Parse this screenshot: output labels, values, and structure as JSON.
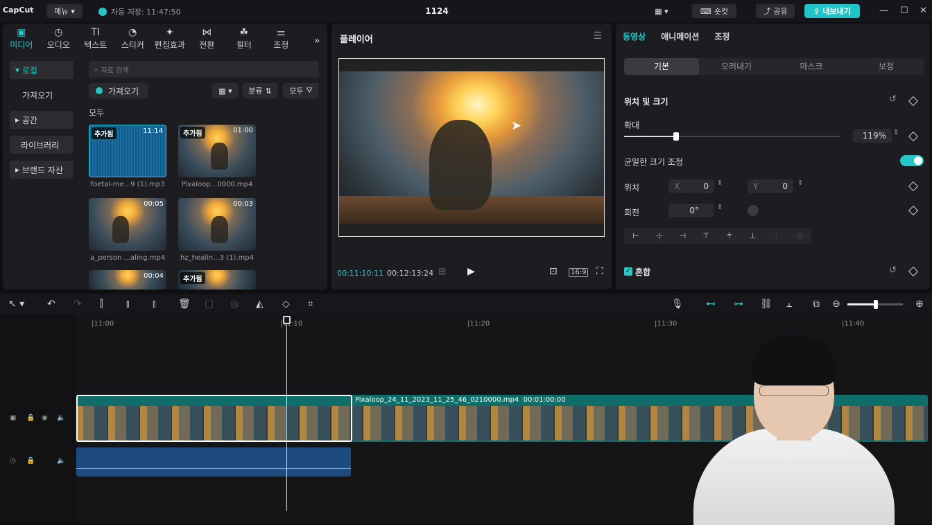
{
  "titlebar": {
    "logo": "CapCut",
    "menu_label": "메뉴",
    "autosave": "자동 저장: 11:47:50",
    "project_title": "1124",
    "shortcut_label": "숏컷",
    "share_label": "공유",
    "export_label": "내보내기"
  },
  "media_tabs": [
    {
      "label": "미디어",
      "icon": "media-icon"
    },
    {
      "label": "오디오",
      "icon": "audio-icon"
    },
    {
      "label": "텍스트",
      "icon": "text-icon"
    },
    {
      "label": "스티커",
      "icon": "sticker-icon"
    },
    {
      "label": "편집효과",
      "icon": "effects-icon"
    },
    {
      "label": "전환",
      "icon": "transition-icon"
    },
    {
      "label": "필터",
      "icon": "filter-icon"
    },
    {
      "label": "조정",
      "icon": "adjust-icon"
    }
  ],
  "sidebar": {
    "local": "로컬",
    "import": "가져오기",
    "space": "공간",
    "library": "라이브러리",
    "brand": "브랜드 자산"
  },
  "media": {
    "search_placeholder": "자료 검색",
    "import_button": "가져오기",
    "sort_label": "분류",
    "all_filter": "모두",
    "all_label": "모두",
    "items": [
      {
        "badge": "추가됨",
        "duration": "11:14",
        "name": "foetal-me...9 (1).mp3"
      },
      {
        "badge": "추가됨",
        "duration": "01:00",
        "name": "Pixaloop...0000.mp4"
      },
      {
        "badge": "",
        "duration": "00:05",
        "name": "a_person ...aling.mp4"
      },
      {
        "badge": "",
        "duration": "00:03",
        "name": "hz_healin...3 (1).mp4"
      },
      {
        "badge": "",
        "duration": "00:04",
        "name": ""
      },
      {
        "badge": "추가됨",
        "duration": "",
        "name": ""
      }
    ]
  },
  "player": {
    "title": "플레이어",
    "current_time": "00:11:10:11",
    "total_time": "00:12:13:24",
    "ratio": "16:9"
  },
  "props": {
    "tabs": [
      "동영상",
      "애니메이션",
      "조정"
    ],
    "subtabs": [
      "기본",
      "오려내기",
      "마스크",
      "보정"
    ],
    "section_title": "위치 및 크기",
    "scale_label": "확대",
    "scale_value": "119%",
    "scale_fraction": 0.24,
    "uniform_label": "균일한 크기 조정",
    "position_label": "위치",
    "pos_x_axis": "X",
    "pos_x": "0",
    "pos_y_axis": "Y",
    "pos_y": "0",
    "rotation_label": "회전",
    "rotation_value": "0°",
    "blend_label": "혼합"
  },
  "timeline": {
    "ruler": [
      "|11:00",
      "|11:10",
      "|11:20",
      "|11:30",
      "|11:40"
    ],
    "clip_title": "Pixaloop_24_11_2023_11_25_46_0210000.mp4",
    "clip_duration": "00:01:00:00"
  },
  "colors": {
    "accent": "#27c7c9",
    "panel": "#1d1d21",
    "clip": "#0f6e6a",
    "audio_clip": "#1d4b80"
  }
}
